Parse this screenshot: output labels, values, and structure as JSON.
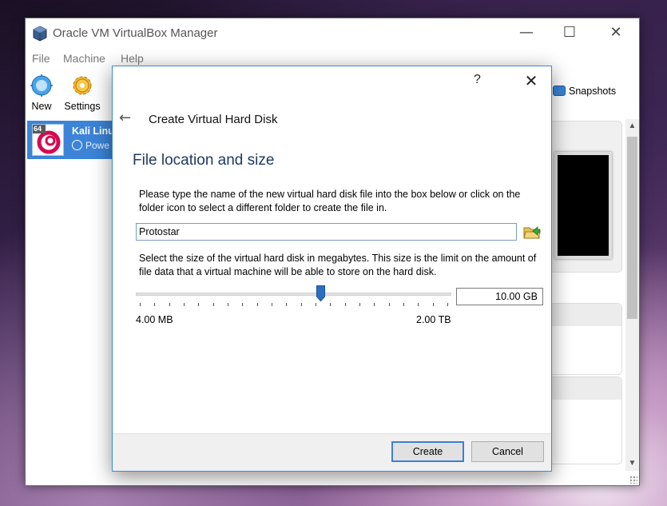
{
  "main_window": {
    "title": "Oracle VM VirtualBox Manager",
    "controls": {
      "minimize": "—",
      "maximize": "☐",
      "close": "✕"
    },
    "menu": [
      "File",
      "Machine",
      "Help"
    ],
    "toolbar": {
      "new_label": "New",
      "settings_label": "Settings",
      "snapshots_label": "Snapshots"
    },
    "vm_list": [
      {
        "name": "Kali Linu",
        "state": "Powe",
        "badge": "64"
      }
    ]
  },
  "dialog": {
    "help": "?",
    "close": "✕",
    "back": "←",
    "title": "Create Virtual Hard Disk",
    "heading": "File location and size",
    "location_description": "Please type the name of the new virtual hard disk file into the box below or click on the folder icon to select a different folder to create the file in.",
    "file_name": "Protostar",
    "size_description": "Select the size of the virtual hard disk in megabytes. This size is the limit on the amount of file data that a virtual machine will be able to store on the hard disk.",
    "size_value": "10.00 GB",
    "slider_position": 0.585,
    "slider_ticks": 22,
    "min_label": "4.00 MB",
    "max_label": "2.00 TB",
    "create_label": "Create",
    "cancel_label": "Cancel"
  },
  "colors": {
    "accent": "#3c8bd8",
    "heading": "#1e3a66",
    "selection": "#3b84d8",
    "slider_thumb": "#2a6fc4"
  }
}
